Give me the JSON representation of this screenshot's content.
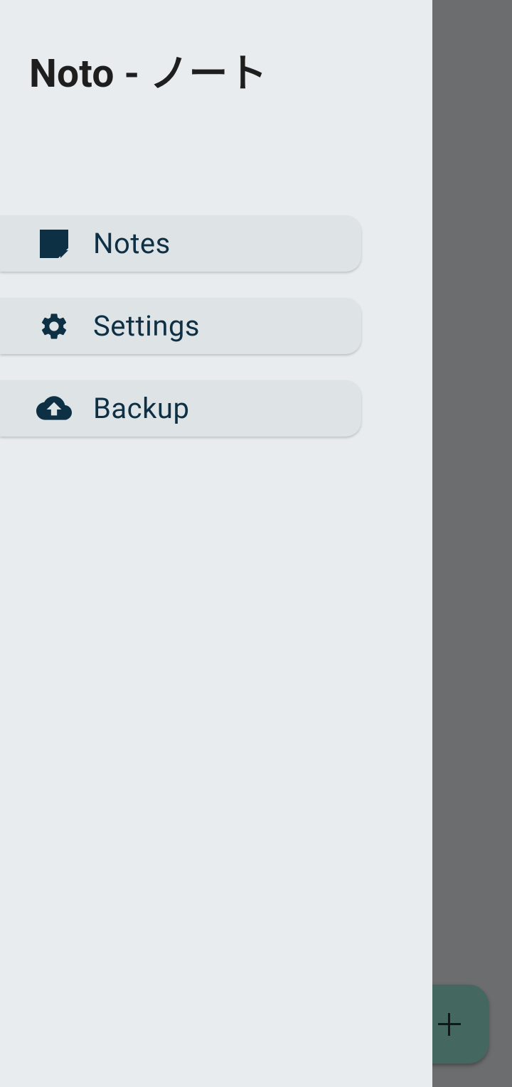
{
  "drawer": {
    "title": "Noto - ノート",
    "items": [
      {
        "label": "Notes",
        "icon": "note-icon"
      },
      {
        "label": "Settings",
        "icon": "gear-icon"
      },
      {
        "label": "Backup",
        "icon": "cloud-upload-icon"
      }
    ]
  },
  "fab": {
    "icon": "plus-icon"
  },
  "colors": {
    "drawer_bg": "#e8ecef",
    "item_bg": "#dee3e6",
    "accent": "#0e3045",
    "scrim": "#6c6d6f",
    "fab_bg": "#446760"
  }
}
